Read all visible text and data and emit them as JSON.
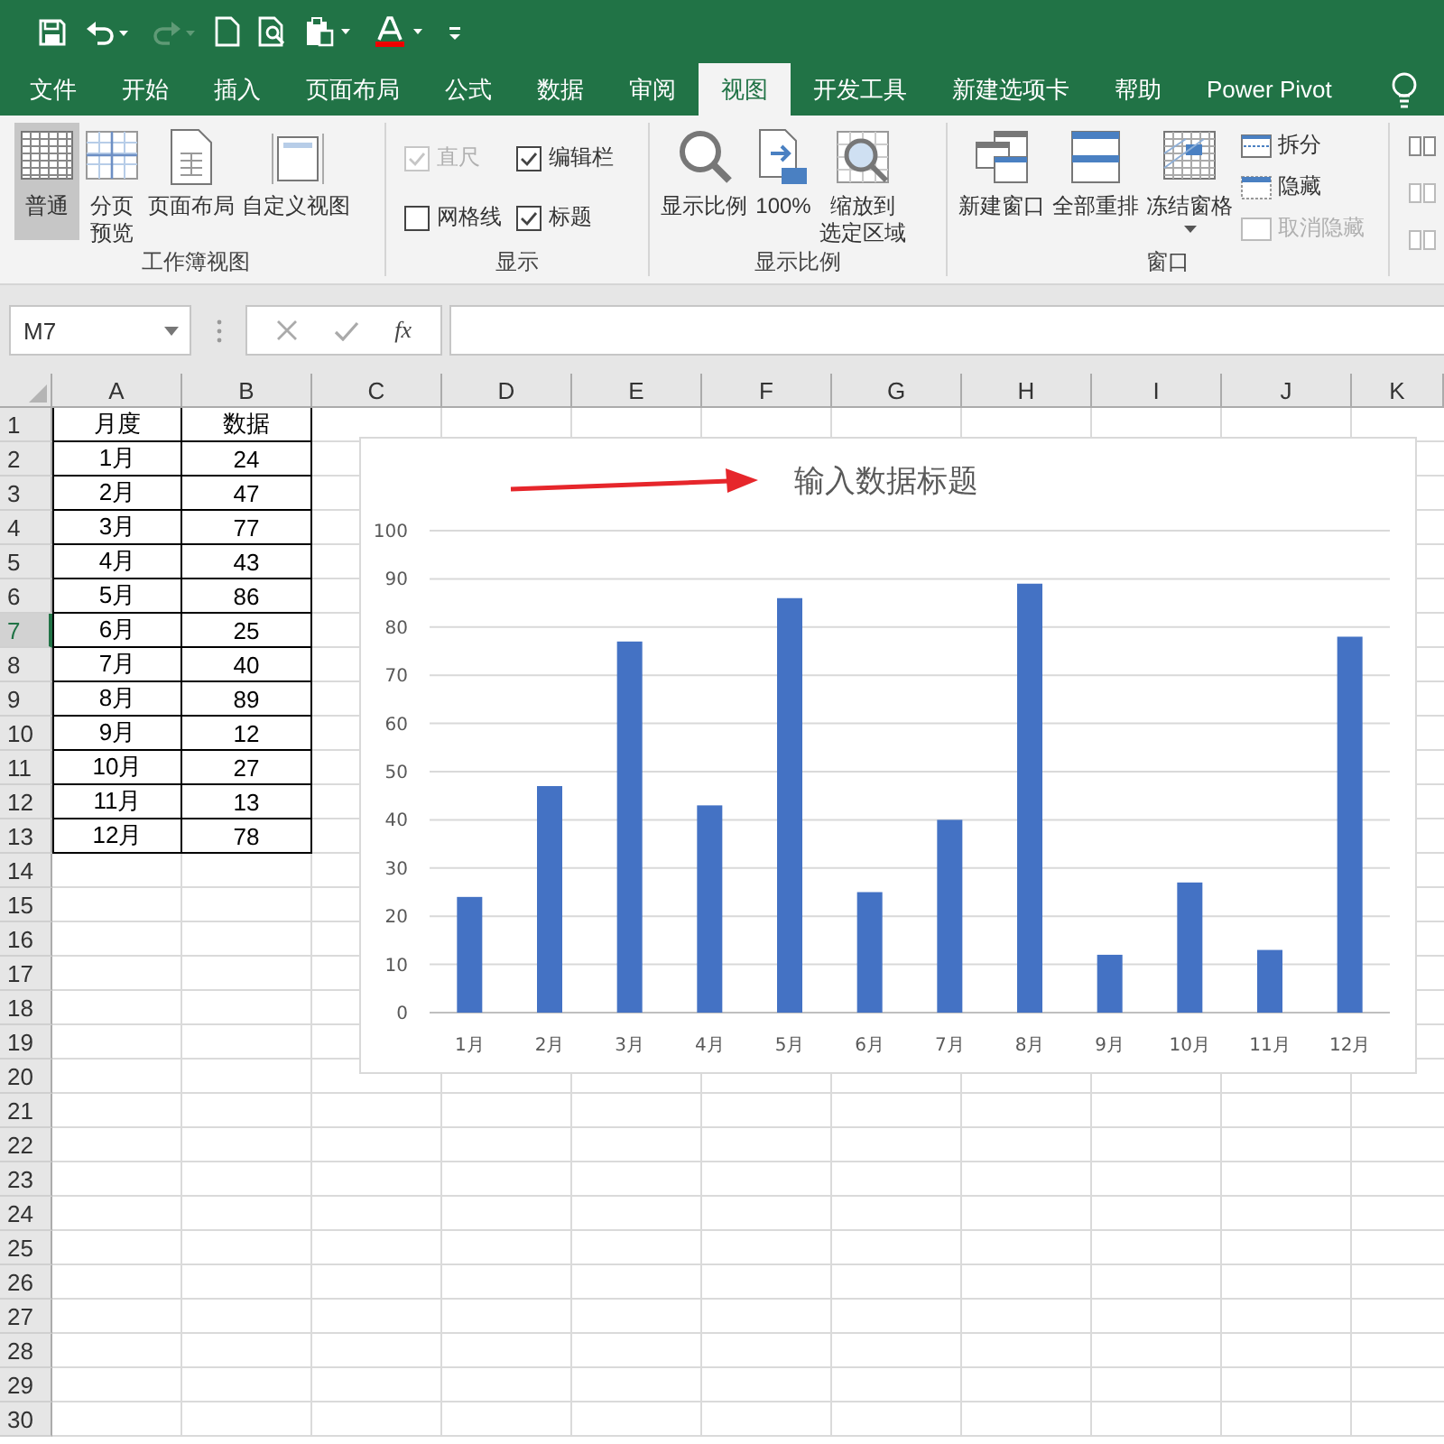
{
  "tabs": [
    {
      "label": "文件",
      "selected": false
    },
    {
      "label": "开始",
      "selected": false
    },
    {
      "label": "插入",
      "selected": false
    },
    {
      "label": "页面布局",
      "selected": false
    },
    {
      "label": "公式",
      "selected": false
    },
    {
      "label": "数据",
      "selected": false
    },
    {
      "label": "审阅",
      "selected": false
    },
    {
      "label": "视图",
      "selected": true
    },
    {
      "label": "开发工具",
      "selected": false
    },
    {
      "label": "新建选项卡",
      "selected": false
    },
    {
      "label": "帮助",
      "selected": false
    },
    {
      "label": "Power Pivot",
      "selected": false
    }
  ],
  "ribbon": {
    "groups": [
      {
        "label": "工作簿视图",
        "items": [
          {
            "kind": "big",
            "label": "普通",
            "selected": true
          },
          {
            "kind": "big",
            "lines": [
              "分页",
              "预览"
            ],
            "selected": false
          },
          {
            "kind": "big",
            "label": "页面布局",
            "selected": false
          },
          {
            "kind": "big",
            "label": "自定义视图",
            "selected": false
          }
        ]
      },
      {
        "label": "显示",
        "items": [
          {
            "kind": "check",
            "label": "直尺",
            "checked": true,
            "disabled": true
          },
          {
            "kind": "check",
            "label": "编辑栏",
            "checked": true,
            "disabled": false
          },
          {
            "kind": "check",
            "label": "网格线",
            "checked": false,
            "disabled": false
          },
          {
            "kind": "check",
            "label": "标题",
            "checked": true,
            "disabled": false
          }
        ]
      },
      {
        "label": "显示比例",
        "items": [
          {
            "kind": "big",
            "label": "显示比例",
            "selected": false
          },
          {
            "kind": "big",
            "label": "100%",
            "selected": false
          },
          {
            "kind": "big",
            "lines": [
              "缩放到",
              "选定区域"
            ],
            "selected": false
          }
        ]
      },
      {
        "label": "窗口",
        "items": [
          {
            "kind": "big",
            "label": "新建窗口",
            "selected": false
          },
          {
            "kind": "big",
            "label": "全部重排",
            "selected": false
          },
          {
            "kind": "big",
            "label": "冻结窗格",
            "selected": false,
            "menu": true
          },
          {
            "kind": "small",
            "label": "拆分",
            "disabled": false
          },
          {
            "kind": "small",
            "label": "隐藏",
            "disabled": false
          },
          {
            "kind": "small",
            "label": "取消隐藏",
            "disabled": true
          }
        ]
      }
    ]
  },
  "formula_bar": {
    "name_box": "M7",
    "function_label": "fx"
  },
  "sheet": {
    "columns": [
      "A",
      "B",
      "C",
      "D",
      "E",
      "F",
      "G",
      "H",
      "I",
      "J",
      "K"
    ],
    "rows": [
      {
        "header": "1",
        "selected": false,
        "cells": [
          "月度",
          "数据"
        ]
      },
      {
        "header": "2",
        "selected": false,
        "cells": [
          "1月",
          "24"
        ]
      },
      {
        "header": "3",
        "selected": false,
        "cells": [
          "2月",
          "47"
        ]
      },
      {
        "header": "4",
        "selected": false,
        "cells": [
          "3月",
          "77"
        ]
      },
      {
        "header": "5",
        "selected": false,
        "cells": [
          "4月",
          "43"
        ]
      },
      {
        "header": "6",
        "selected": false,
        "cells": [
          "5月",
          "86"
        ]
      },
      {
        "header": "7",
        "selected": true,
        "cells": [
          "6月",
          "25"
        ]
      },
      {
        "header": "8",
        "selected": false,
        "cells": [
          "7月",
          "40"
        ]
      },
      {
        "header": "9",
        "selected": false,
        "cells": [
          "8月",
          "89"
        ]
      },
      {
        "header": "10",
        "selected": false,
        "cells": [
          "9月",
          "12"
        ]
      },
      {
        "header": "11",
        "selected": false,
        "cells": [
          "10月",
          "27"
        ]
      },
      {
        "header": "12",
        "selected": false,
        "cells": [
          "11月",
          "13"
        ]
      },
      {
        "header": "13",
        "selected": false,
        "cells": [
          "12月",
          "78"
        ]
      },
      {
        "header": "14",
        "selected": false
      },
      {
        "header": "15",
        "selected": false
      },
      {
        "header": "16",
        "selected": false
      },
      {
        "header": "17",
        "selected": false
      },
      {
        "header": "18",
        "selected": false
      },
      {
        "header": "19",
        "selected": false
      },
      {
        "header": "20",
        "selected": false
      },
      {
        "header": "21",
        "selected": false
      },
      {
        "header": "22",
        "selected": false
      },
      {
        "header": "23",
        "selected": false
      },
      {
        "header": "24",
        "selected": false
      },
      {
        "header": "25",
        "selected": false
      },
      {
        "header": "26",
        "selected": false
      },
      {
        "header": "27",
        "selected": false
      },
      {
        "header": "28",
        "selected": false
      },
      {
        "header": "29",
        "selected": false
      },
      {
        "header": "30",
        "selected": false
      }
    ]
  },
  "chart": {
    "chart_data": {
      "type": "bar",
      "title": "输入数据标题",
      "categories": [
        "1月",
        "2月",
        "3月",
        "4月",
        "5月",
        "6月",
        "7月",
        "8月",
        "9月",
        "10月",
        "11月",
        "12月"
      ],
      "grid": true,
      "series": [
        {
          "color": "#4472c4",
          "values": [
            24,
            47,
            77,
            43,
            86,
            25,
            40,
            89,
            12,
            27,
            13,
            78
          ]
        }
      ],
      "ylim": [
        0,
        100
      ],
      "yticks": [
        0,
        10,
        20,
        30,
        40,
        50,
        60,
        70,
        80,
        90,
        100
      ]
    }
  }
}
